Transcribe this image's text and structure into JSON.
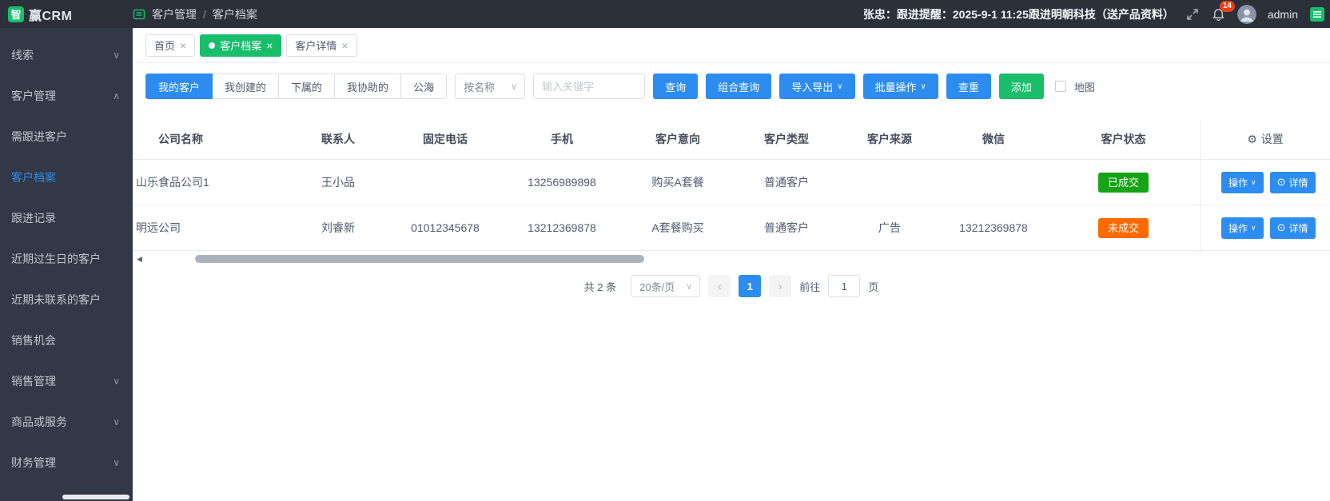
{
  "colors": {
    "primary_blue": "#2d8cf0",
    "success_green": "#19be6b",
    "status_done_green": "#16a316",
    "status_pending_orange": "#ff6a00",
    "notification_red": "#ed4014",
    "topbar_bg": "#2b303b",
    "sidebar_bg": "#323845"
  },
  "icons": {
    "close": "×",
    "chevron_down": "∨",
    "chevron_up": "∧",
    "gear": "⚙",
    "detail": "⊙",
    "scroll_left": "◀",
    "prev": "‹",
    "next": "›"
  },
  "topbar": {
    "logo_box": "智",
    "logo_text": "赢CRM",
    "breadcrumb": {
      "section": "客户管理",
      "separator": "/",
      "page": "客户档案"
    },
    "reminder": "张忠：跟进提醒：2025-9-1 11:25跟进明朝科技（送产品资料）",
    "notification_count": "14",
    "username": "admin"
  },
  "sidebar": {
    "items": [
      {
        "label": "线索",
        "type": "parent"
      },
      {
        "label": "客户管理",
        "type": "parent",
        "expanded": true
      },
      {
        "label": "需跟进客户",
        "type": "child"
      },
      {
        "label": "客户档案",
        "type": "child",
        "active": true
      },
      {
        "label": "跟进记录",
        "type": "child"
      },
      {
        "label": "近期过生日的客户",
        "type": "child"
      },
      {
        "label": "近期未联系的客户",
        "type": "child"
      },
      {
        "label": "销售机会",
        "type": "child"
      },
      {
        "label": "销售管理",
        "type": "parent"
      },
      {
        "label": "商品或服务",
        "type": "parent"
      },
      {
        "label": "财务管理",
        "type": "parent"
      }
    ]
  },
  "tabs": [
    {
      "label": "首页"
    },
    {
      "label": "客户档案",
      "active": true
    },
    {
      "label": "客户详情"
    }
  ],
  "toolbar": {
    "filters": [
      "我的客户",
      "我创建的",
      "下属的",
      "我协助的",
      "公海"
    ],
    "active_filter": "我的客户",
    "search_type": "按名称",
    "keyword_placeholder": "输入关键字",
    "query": "查询",
    "combo_query": "组合查询",
    "import_export": "导入导出",
    "batch_ops": "批量操作",
    "dedupe": "查重",
    "add": "添加",
    "map": "地图"
  },
  "table": {
    "columns": [
      "公司名称",
      "联系人",
      "固定电话",
      "手机",
      "客户意向",
      "客户类型",
      "客户来源",
      "微信",
      "客户状态"
    ],
    "settings": "设置",
    "action_label": "操作",
    "detail_label": "详情",
    "rows": [
      {
        "company": "山乐食品公司1",
        "contact": "王小品",
        "tel": "",
        "mobile": "13256989898",
        "intent": "购买A套餐",
        "type": "普通客户",
        "source": "",
        "wechat": "",
        "status": "已成交"
      },
      {
        "company": "明远公司",
        "contact": "刘睿新",
        "tel": "01012345678",
        "mobile": "13212369878",
        "intent": "A套餐购买",
        "type": "普通客户",
        "source": "广告",
        "wechat": "13212369878",
        "status": "未成交"
      }
    ]
  },
  "pagination": {
    "total": "共 2 条",
    "page_size": "20条/页",
    "page": "1",
    "goto_prefix": "前往",
    "goto_value": "1",
    "goto_suffix": "页"
  }
}
